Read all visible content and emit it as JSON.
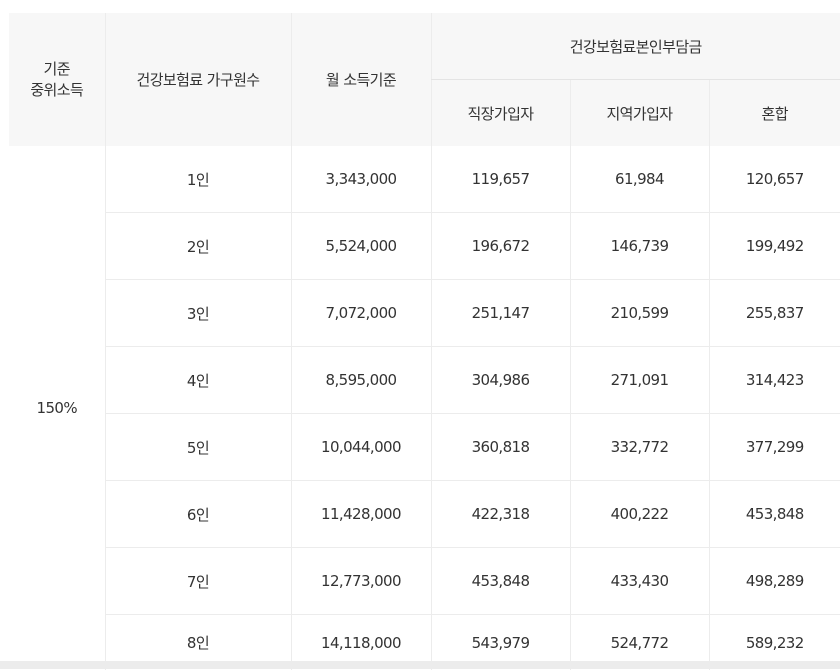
{
  "header": {
    "median_income": "기준\n중위소득",
    "household": "건강보험료 가구원수",
    "monthly_income": "월 소득기준",
    "premium_group": "건강보험료본인부담금",
    "employee": "직장가입자",
    "regional": "지역가입자",
    "mixed": "혼합"
  },
  "median_value": "150%",
  "rows": [
    {
      "household": "1인",
      "income": "3,343,000",
      "employee": "119,657",
      "regional": "61,984",
      "mixed": "120,657"
    },
    {
      "household": "2인",
      "income": "5,524,000",
      "employee": "196,672",
      "regional": "146,739",
      "mixed": "199,492"
    },
    {
      "household": "3인",
      "income": "7,072,000",
      "employee": "251,147",
      "regional": "210,599",
      "mixed": "255,837"
    },
    {
      "household": "4인",
      "income": "8,595,000",
      "employee": "304,986",
      "regional": "271,091",
      "mixed": "314,423"
    },
    {
      "household": "5인",
      "income": "10,044,000",
      "employee": "360,818",
      "regional": "332,772",
      "mixed": "377,299"
    },
    {
      "household": "6인",
      "income": "11,428,000",
      "employee": "422,318",
      "regional": "400,222",
      "mixed": "453,848"
    },
    {
      "household": "7인",
      "income": "12,773,000",
      "employee": "453,848",
      "regional": "433,430",
      "mixed": "498,289"
    },
    {
      "household": "8인",
      "income": "14,118,000",
      "employee": "543,979",
      "regional": "524,772",
      "mixed": "589,232"
    }
  ]
}
